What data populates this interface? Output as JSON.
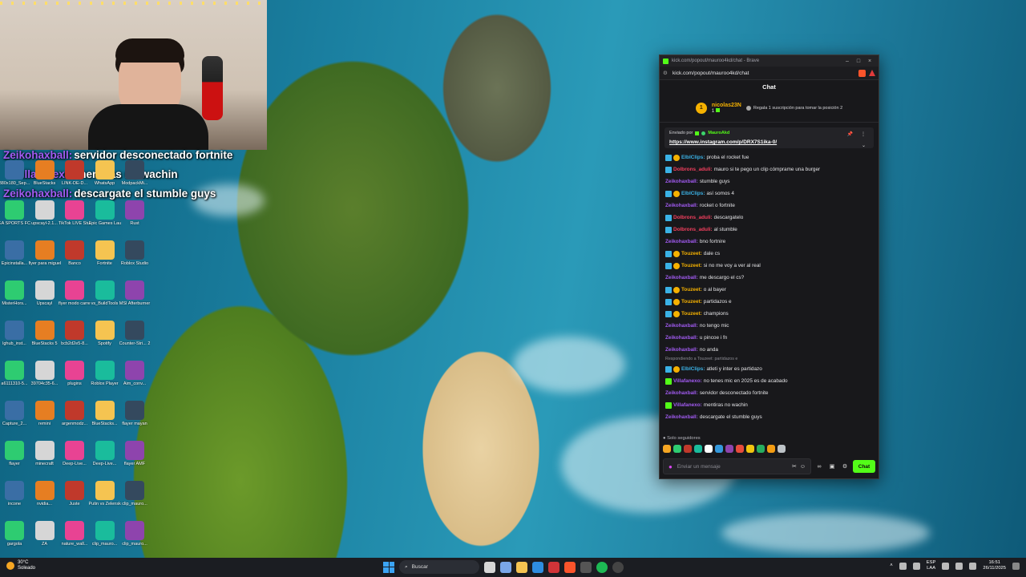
{
  "overlay_chat": [
    {
      "user": "Zeikohaxball:",
      "text": "servidor desconectado fortnite",
      "color": "#a25bf2"
    },
    {
      "user": "Villafanexo:",
      "text": "mentiras no wachin",
      "color": "#a25bf2"
    },
    {
      "user": "Zeikohaxball:",
      "text": "descargate el stumble guys",
      "color": "#a25bf2"
    }
  ],
  "desktop_icons": [
    "380x180_Sep...",
    "BlueStacks",
    "LINK-DE-D...",
    "WhatsApp",
    "ModpackMi...",
    "EA SPORTS FC 26",
    "upscayl-2.1...",
    "TikTok LIVE Studio",
    "Epic Games Launcher",
    "Rust",
    "Epicinstalla...",
    "flyer para miguel",
    "Banco",
    "Fortnite",
    "Roblox Studio",
    "MisterHors...",
    "Upscayl",
    "flyer modo carrera",
    "vs_BuildTools",
    "MSI Afterburner",
    "lghub_inst...",
    "BlueStacks 5",
    "bcb2d2e5-8...",
    "Spotify",
    "Counter-Stri... 2",
    "a6111310-5...",
    "39704c35-6...",
    "plugins",
    "Roblox Player",
    "Aim_conv...",
    "Capture_2...",
    "remini",
    "argenmodz...",
    "BlueStacks...",
    "flayer mayan",
    "flayer",
    "minecraft",
    "Deep-Live...",
    "Deep-Live...",
    "flayer AMF",
    "incone",
    "nvidia...",
    "Juste",
    "Putin vs Zelensky",
    "clip_mauro...",
    "gargola",
    "ZA",
    "nature_wall...",
    "clip_mauro...",
    "clip_mauro..."
  ],
  "browser": {
    "window_title": "kick.com/popout/mauroo4kd/chat - Brave",
    "url": "kick.com/popout/mauroo4kd/chat",
    "chat_title": "Chat"
  },
  "top_gifter": {
    "rank": "1",
    "name": "nicolas23N",
    "count": "1",
    "tip": "Regala 1 suscripción para tomar la posición 2"
  },
  "pinned": {
    "sent_by_label": "Enviado por",
    "sender": "MauroAkd",
    "link": "https://www.instagram.com/p/DRX7S1ika-0/"
  },
  "messages": [
    {
      "user": "ElbIClips:",
      "text": "proba el rocket fue",
      "color": "#3ab2e6",
      "badges": [
        "blue",
        "yellow"
      ]
    },
    {
      "user": "Dolbrons_aduli:",
      "text": "mauro si te pego un clip cómprame una burger",
      "color": "#f43f5e",
      "badges": [
        "blue"
      ]
    },
    {
      "user": "Zeikohaxball:",
      "text": "stumble guys",
      "color": "#a25bf2",
      "badges": []
    },
    {
      "user": "ElbIClips:",
      "text": "así somos 4",
      "color": "#3ab2e6",
      "badges": [
        "blue",
        "yellow"
      ]
    },
    {
      "user": "Zeikohaxball:",
      "text": "rocket o fortnite",
      "color": "#a25bf2",
      "badges": []
    },
    {
      "user": "Dolbrons_aduli:",
      "text": "descargatelo",
      "color": "#f43f5e",
      "badges": [
        "blue"
      ]
    },
    {
      "user": "Dolbrons_aduli:",
      "text": "al stumble",
      "color": "#f43f5e",
      "badges": [
        "blue"
      ]
    },
    {
      "user": "Zeikohaxball:",
      "text": "bno fortnire",
      "color": "#a25bf2",
      "badges": []
    },
    {
      "user": "Touzeet:",
      "text": "dale cs",
      "color": "#f5b100",
      "badges": [
        "blue",
        "yellow"
      ]
    },
    {
      "user": "Touzeet:",
      "text": "si no me voy a ver al real",
      "color": "#f5b100",
      "badges": [
        "blue",
        "yellow"
      ]
    },
    {
      "user": "Zeikohaxball:",
      "text": "me descargo el cs?",
      "color": "#a25bf2",
      "badges": []
    },
    {
      "user": "Touzeet:",
      "text": "o al bayer",
      "color": "#f5b100",
      "badges": [
        "blue",
        "yellow"
      ]
    },
    {
      "user": "Touzeet:",
      "text": "partidazos e",
      "color": "#f5b100",
      "badges": [
        "blue",
        "yellow"
      ]
    },
    {
      "user": "Touzeet:",
      "text": "champions",
      "color": "#f5b100",
      "badges": [
        "blue",
        "yellow"
      ]
    },
    {
      "user": "Zeikohaxball:",
      "text": "no tengo mic",
      "color": "#a25bf2",
      "badges": []
    },
    {
      "user": "Zeikohaxball:",
      "text": "u pincoe i fn",
      "color": "#a25bf2",
      "badges": []
    },
    {
      "user": "Zeikohaxball:",
      "text": "no anda",
      "color": "#a25bf2",
      "badges": []
    },
    {
      "user": "ElbIClips:",
      "text": "atleti y inter es partidazo",
      "color": "#3ab2e6",
      "badges": [
        "blue",
        "yellow"
      ],
      "reply": "Respondiendo a Touzeet: partidazos e"
    },
    {
      "user": "Villafanexo:",
      "text": "no tenes mic en 2025 es de acabado",
      "color": "#a25bf2",
      "badges": [
        "green"
      ]
    },
    {
      "user": "Zeikohaxball:",
      "text": "servidor desconectado fortnite",
      "color": "#a25bf2",
      "badges": []
    },
    {
      "user": "Villafanexo:",
      "text": "mentiras no wachin",
      "color": "#a25bf2",
      "badges": [
        "green"
      ]
    },
    {
      "user": "Zeikohaxball:",
      "text": "descargate el stumble guys",
      "color": "#a25bf2",
      "badges": []
    }
  ],
  "chat_footer": {
    "followers_only": "Solo seguidores",
    "input_placeholder": "Enviar un mensaje",
    "send_label": "Chat"
  },
  "emote_colors": [
    "#f5a623",
    "#2ecc71",
    "#c0392b",
    "#1abc9c",
    "#ffffff",
    "#3498db",
    "#8e44ad",
    "#e74c3c",
    "#f1c40f",
    "#27ae60",
    "#f39c12",
    "#bdc3c7"
  ],
  "taskbar": {
    "weather_temp": "30°C",
    "weather_desc": "Soleado",
    "search_placeholder": "Buscar",
    "lang_top": "ESP",
    "lang_bottom": "LAA",
    "time": "16:51",
    "date": "26/11/2025"
  }
}
